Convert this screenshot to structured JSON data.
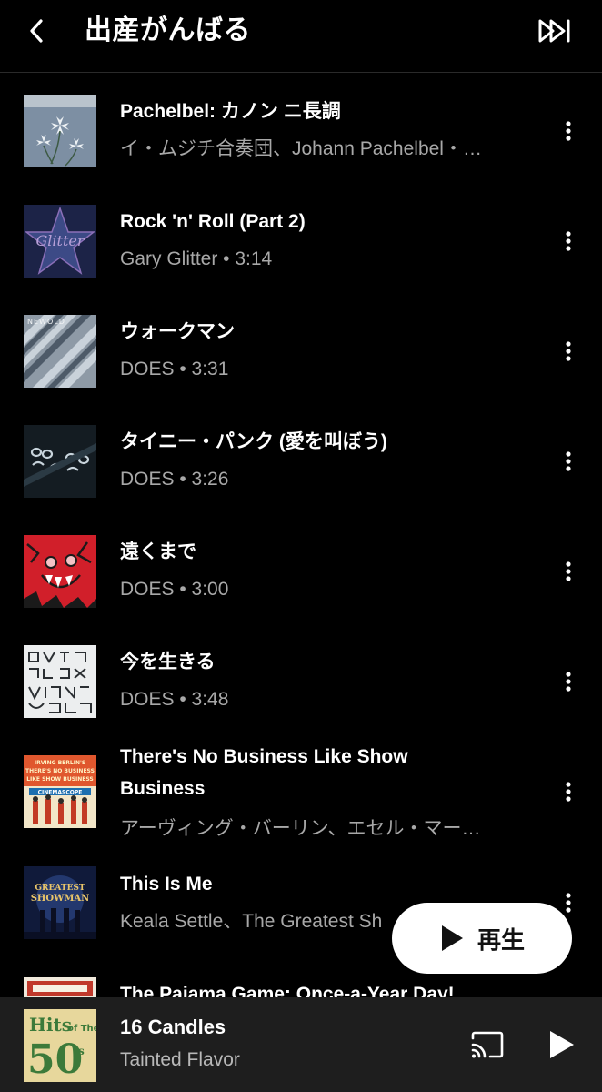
{
  "header": {
    "title": "出産がんばる"
  },
  "tracks": [
    {
      "title": "Pachelbel: カノン ニ長調",
      "subtitle": "イ・ムジチ合奏団、Johann Pachelbel・…",
      "art": "flowers-icon"
    },
    {
      "title": "Rock 'n' Roll (Part 2)",
      "subtitle": "Gary Glitter • 3:14",
      "art": "glitter-star-icon"
    },
    {
      "title": "ウォークマン",
      "subtitle": "DOES • 3:31",
      "art": "stripes-art"
    },
    {
      "title": "タイニー・パンク (愛を叫ぼう)",
      "subtitle": "DOES • 3:26",
      "art": "dark-letters-art"
    },
    {
      "title": "遠くまで",
      "subtitle": "DOES • 3:00",
      "art": "red-monster-art"
    },
    {
      "title": "今を生きる",
      "subtitle": "DOES • 3:48",
      "art": "white-letters-art"
    },
    {
      "title": "There's No Business Like Show Business",
      "subtitle": "アーヴィング・バーリン、エセル・マー…",
      "art": "show-business-poster"
    },
    {
      "title": "This Is Me",
      "subtitle": "Keala Settle、The Greatest Sh",
      "art": "greatest-showman-poster"
    },
    {
      "title": "The Pajama Game: Once-a-Year Day!",
      "subtitle": "",
      "art": "pajama-game-art"
    }
  ],
  "fab": {
    "label": "再生"
  },
  "player": {
    "title": "16 Candles",
    "artist": "Tainted Flavor",
    "art": "hits-of-the-50s-art"
  },
  "colors": {
    "background": "#000000",
    "secondary_text": "#a8a8a8",
    "player_bg": "#1e1e1e"
  }
}
